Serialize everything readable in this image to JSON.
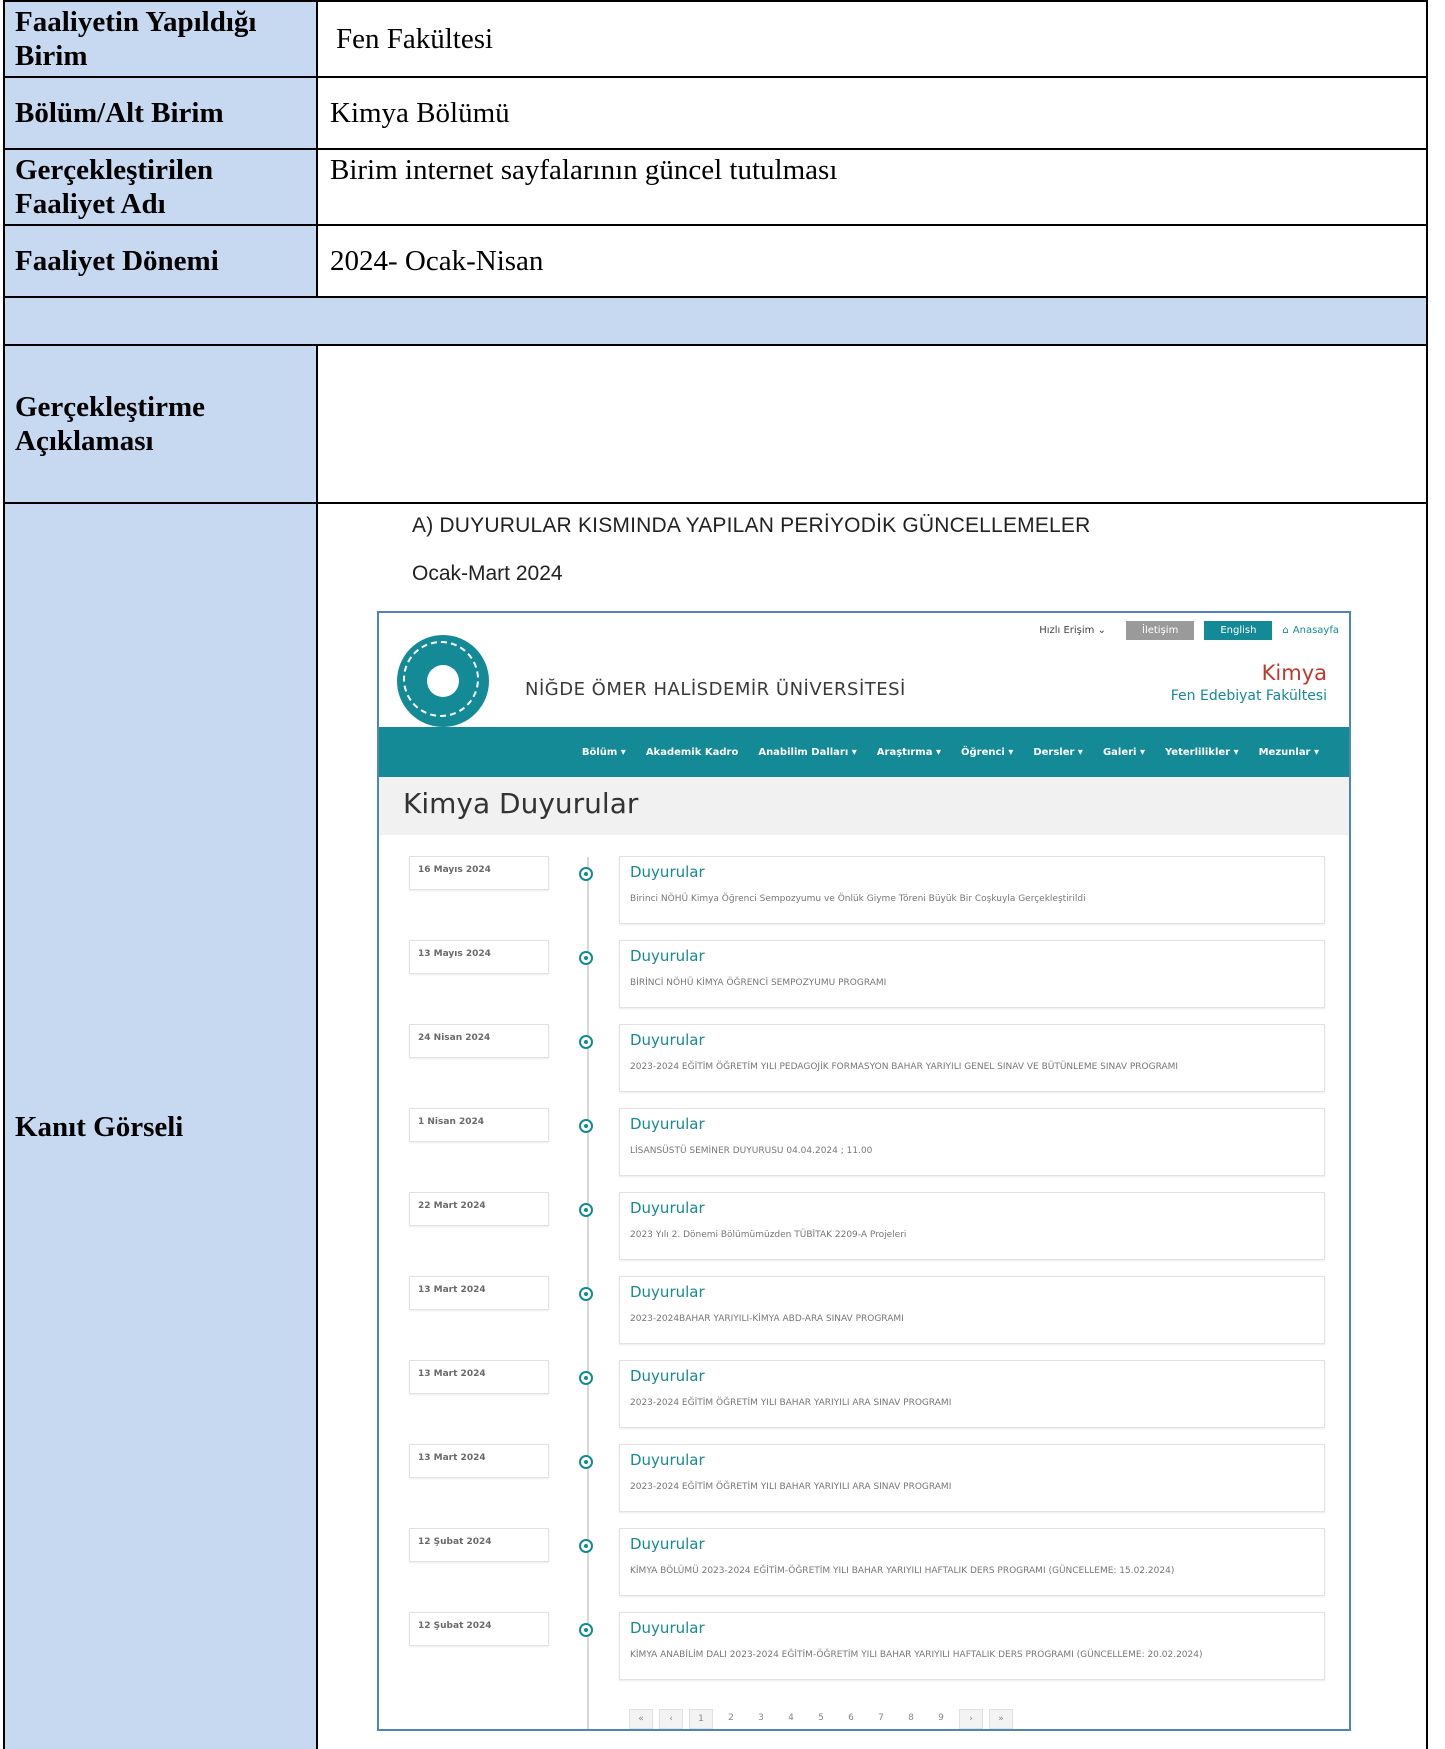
{
  "form": {
    "unit_label": "Faaliyetin Yapıldığı Birim",
    "unit_value": "Fen Fakültesi",
    "dept_label": "Bölüm/Alt Birim",
    "dept_value": "Kimya Bölümü",
    "activity_label": "Gerçekleştirilen Faaliyet Adı",
    "activity_value": "Birim internet sayfalarının güncel tutulması",
    "period_label": "Faaliyet Dönemi",
    "period_value": "2024- Ocak-Nisan",
    "explanation_label": "Gerçekleştirme Açıklaması",
    "evidence_label": "Kanıt Görseli"
  },
  "evidence": {
    "heading": "A)  DUYURULAR KISMINDA YAPILAN PERİYODİK GÜNCELLEMELER",
    "period": "Ocak-Mart 2024",
    "site": {
      "quick_access": "Hızlı Erişim",
      "contact": "İletişim",
      "english": "English",
      "home": "Anasayfa",
      "university": "NİĞDE ÖMER HALİSDEMİR ÜNİVERSİTESİ",
      "department": "Kimya",
      "faculty": "Fen Edebiyat Fakültesi",
      "nav": [
        "Bölüm ▾",
        "Akademik Kadro",
        "Anabilim Dalları ▾",
        "Araştırma ▾",
        "Öğrenci ▾",
        "Dersler ▾",
        "Galeri ▾",
        "Yeterlilikler ▾",
        "Mezunlar ▾"
      ],
      "page_title": "Kimya Duyurular",
      "items": [
        {
          "date": "16 Mayıs 2024",
          "title": "Duyurular",
          "desc": "Birinci NÖHÜ Kimya Öğrenci Sempozyumu ve Önlük Giyme Töreni Büyük Bir Coşkuyla Gerçekleştirildi"
        },
        {
          "date": "13 Mayıs 2024",
          "title": "Duyurular",
          "desc": "BİRİNCİ NÖHÜ KİMYA ÖĞRENCİ SEMPOZYUMU PROGRAMI"
        },
        {
          "date": "24 Nisan 2024",
          "title": "Duyurular",
          "desc": "2023-2024 EĞİTİM ÖĞRETİM YILI PEDAGOJİK FORMASYON BAHAR YARIYILI GENEL SINAV VE BÜTÜNLEME SINAV PROGRAMI"
        },
        {
          "date": "1 Nisan 2024",
          "title": "Duyurular",
          "desc": "LİSANSÜSTÜ SEMİNER DUYURUSU 04.04.2024 ; 11.00"
        },
        {
          "date": "22 Mart 2024",
          "title": "Duyurular",
          "desc": "2023 Yılı 2. Dönemi Bölümümüzden TÜBİTAK 2209-A Projeleri"
        },
        {
          "date": "13 Mart 2024",
          "title": "Duyurular",
          "desc": "2023-2024BAHAR YARIYILI-KİMYA ABD-ARA SINAV PROGRAMI"
        },
        {
          "date": "13 Mart 2024",
          "title": "Duyurular",
          "desc": "2023-2024 EĞİTİM ÖĞRETİM YILI BAHAR YARIYILI ARA SINAV PROGRAMI"
        },
        {
          "date": "13 Mart 2024",
          "title": "Duyurular",
          "desc": "2023-2024 EĞİTİM ÖĞRETİM YILI BAHAR YARIYILI ARA SINAV PROGRAMI"
        },
        {
          "date": "12 Şubat 2024",
          "title": "Duyurular",
          "desc": "KİMYA BÖLÜMÜ 2023-2024 EĞİTİM-ÖĞRETİM YILI BAHAR YARIYILI HAFTALIK DERS PROGRAMI (GÜNCELLEME: 15.02.2024)"
        },
        {
          "date": "12 Şubat 2024",
          "title": "Duyurular",
          "desc": "KİMYA ANABİLİM DALI 2023-2024 EĞİTİM-ÖĞRETİM YILI BAHAR YARIYILI HAFTALIK DERS PROGRAMI (GÜNCELLEME: 20.02.2024)"
        }
      ],
      "pager": [
        "«",
        "‹",
        "1",
        "2",
        "3",
        "4",
        "5",
        "6",
        "7",
        "8",
        "9",
        "›",
        "»"
      ]
    }
  }
}
